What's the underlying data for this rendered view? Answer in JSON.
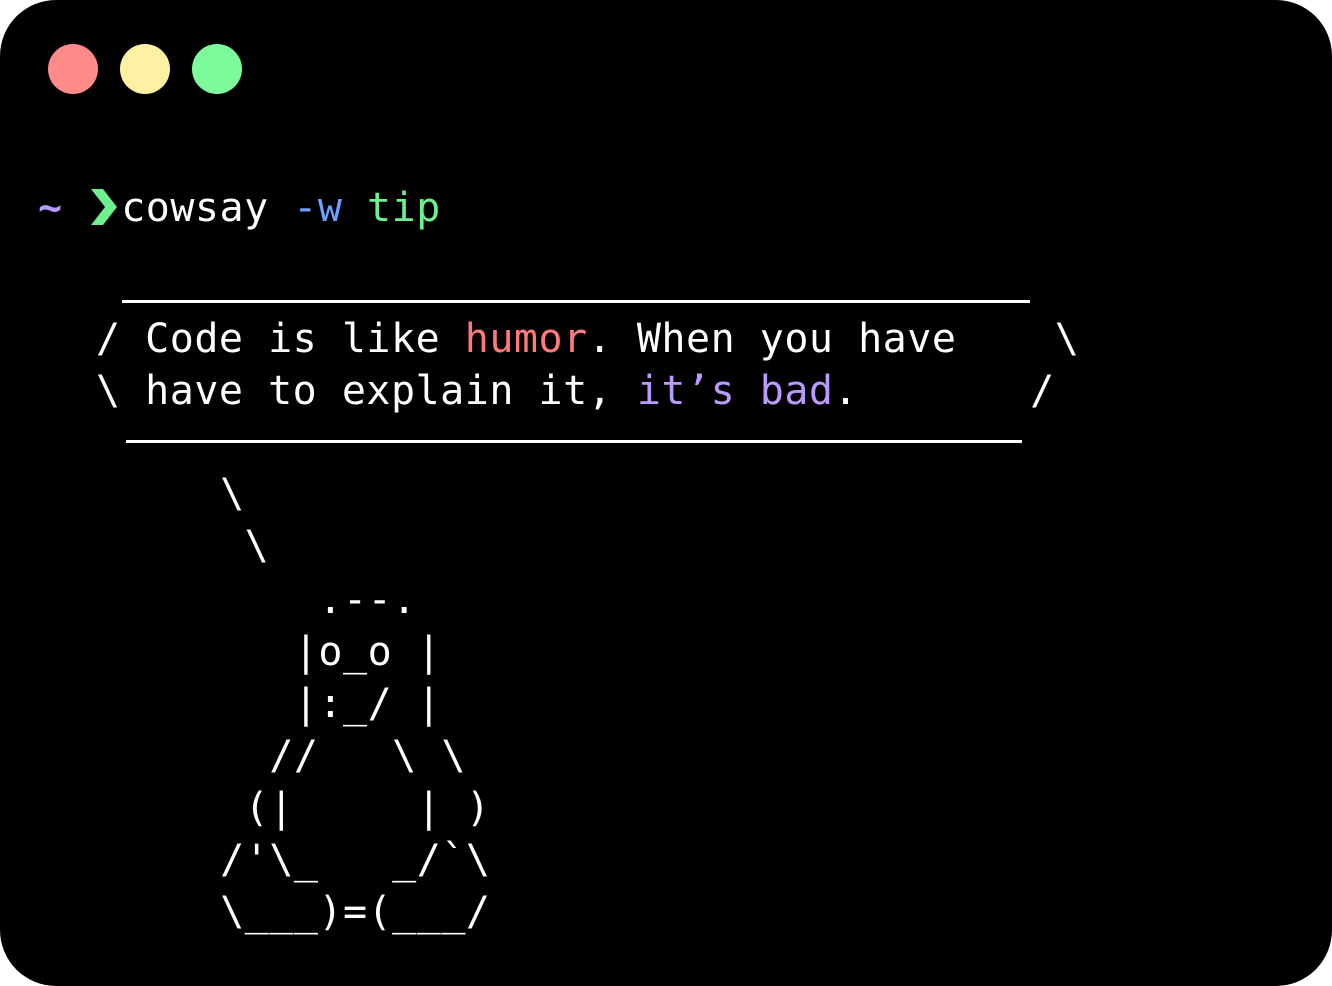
{
  "window": {
    "controls": [
      "close",
      "minimize",
      "maximize"
    ],
    "colors": {
      "close": "#ff8a8a",
      "minimize": "#fff1a3",
      "maximize": "#7dfa9a",
      "background": "#000000"
    }
  },
  "prompt": {
    "tilde": "~",
    "command": "cowsay",
    "flag": "-w",
    "arg": "tip"
  },
  "bubble": {
    "line1": {
      "open": "/",
      "pre": " Code is like ",
      "highlight": "humor",
      "post": ". When you have    ",
      "close": "\\"
    },
    "line2": {
      "open": "\\",
      "pre": " have to explain it, ",
      "highlight1": "it’s",
      "mid": " ",
      "highlight2": "bad",
      "post": ".       ",
      "close": "/"
    },
    "colors": {
      "highlight_red": "#ff7b7b",
      "highlight_purple": "#b99bff"
    }
  },
  "art": [
    "       \\",
    "        \\",
    "           .--.",
    "          |o_o |",
    "          |:_/ |",
    "         //   \\ \\",
    "        (|     | )",
    "       /'\\_   _/`\\",
    "       \\___)=(___/"
  ]
}
